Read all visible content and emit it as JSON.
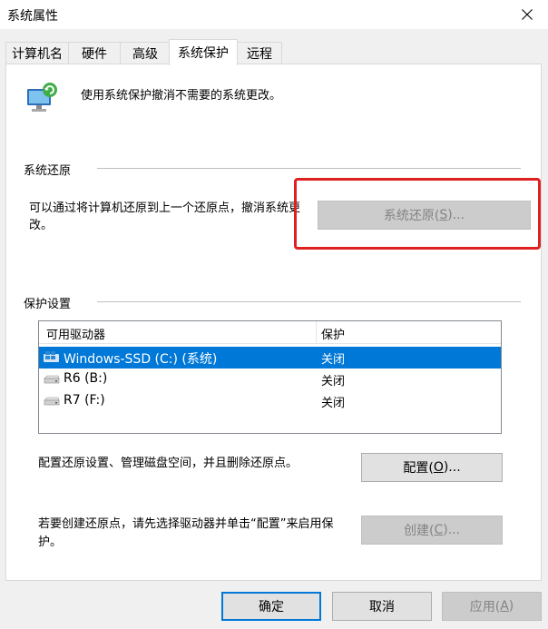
{
  "window": {
    "title": "系统属性"
  },
  "tabs": [
    {
      "label": "计算机名"
    },
    {
      "label": "硬件"
    },
    {
      "label": "高级"
    },
    {
      "label": "系统保护",
      "active": true
    },
    {
      "label": "远程"
    }
  ],
  "intro": {
    "text": "使用系统保护撤消不需要的系统更改。",
    "icon": "system-protection-icon"
  },
  "restore": {
    "group_label": "系统还原",
    "description": "可以通过将计算机还原到上一个还原点，撤消系统更改。",
    "button_label_pre": "系统还原(",
    "button_label_key": "S",
    "button_label_post": ")...",
    "button_enabled": false
  },
  "protection": {
    "group_label": "保护设置",
    "columns": [
      "可用驱动器",
      "保护"
    ],
    "drives": [
      {
        "name": "Windows-SSD (C:) (系统)",
        "status": "关闭",
        "selected": true,
        "icon": "windows-drive-icon"
      },
      {
        "name": "R6 (B:)",
        "status": "关闭",
        "selected": false,
        "icon": "drive-icon"
      },
      {
        "name": "R7 (F:)",
        "status": "关闭",
        "selected": false,
        "icon": "drive-icon"
      }
    ],
    "configure_desc": "配置还原设置、管理磁盘空间，并且删除还原点。",
    "configure_pre": "配置(",
    "configure_key": "O",
    "configure_post": ")...",
    "create_desc": "若要创建还原点，请先选择驱动器并单击“配置”来启用保护。",
    "create_pre": "创建(",
    "create_key": "C",
    "create_post": ")...",
    "create_enabled": false
  },
  "footer": {
    "ok_label": "确定",
    "cancel_label": "取消",
    "apply_pre": "应用(",
    "apply_key": "A",
    "apply_post": ")",
    "apply_enabled": false
  },
  "colors": {
    "selection": "#0078d7",
    "highlight_box": "#e02020"
  }
}
